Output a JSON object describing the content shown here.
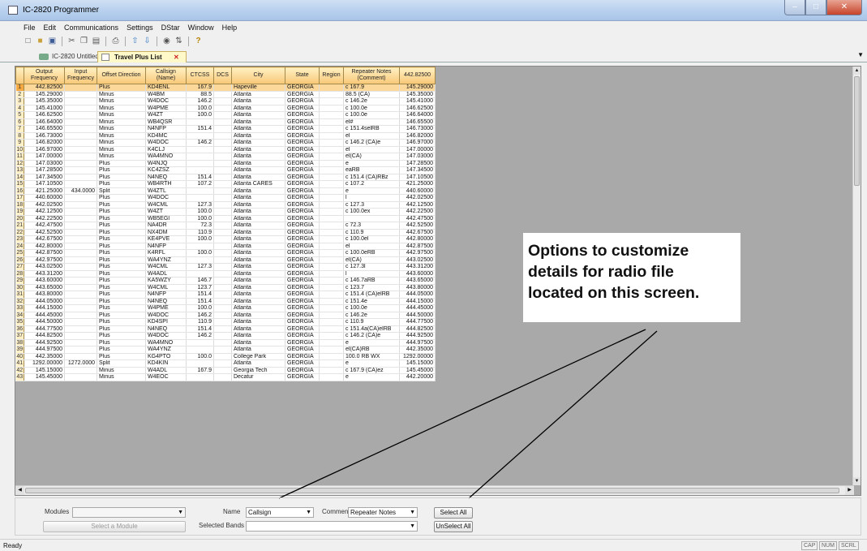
{
  "window": {
    "title": "IC-2820 Programmer",
    "controls": [
      "–",
      "□",
      "✕"
    ]
  },
  "menu": [
    "File",
    "Edit",
    "Communications",
    "Settings",
    "DStar",
    "Window",
    "Help"
  ],
  "toolbar_icons": [
    "new-icon",
    "open-icon",
    "save-icon",
    "cut-icon",
    "copy-icon",
    "paste-icon",
    "print-icon",
    "upload-icon",
    "download-icon",
    "binoculars-icon",
    "sort-icon",
    "help-icon"
  ],
  "tabs": {
    "doc1": "IC-2820 Untitled",
    "doc2": "Travel Plus List",
    "close": "✕",
    "dropdown": "▼"
  },
  "grid": {
    "headers": [
      "Output Frequency",
      "Input Frequency",
      "Offset Direction",
      "Callsign (Name)",
      "CTCSS",
      "DCS",
      "City",
      "State",
      "Region",
      "Repeater Notes (Comment)",
      "442.82500"
    ],
    "rows": [
      [
        "1",
        "442.82500",
        "",
        "Plus",
        "KD4ENL",
        "167.9",
        "",
        "Hapeville",
        "GEORGIA",
        "",
        "c 167.9",
        "145.29000"
      ],
      [
        "2",
        "145.29000",
        "",
        "Minus",
        "W4BM",
        "88.5",
        "",
        "Atlanta",
        "GEORGIA",
        "",
        "88.5 (CA)",
        "145.35000"
      ],
      [
        "3",
        "145.35000",
        "",
        "Minus",
        "W4DOC",
        "146.2",
        "",
        "Atlanta",
        "GEORGIA",
        "",
        "c 146.2e",
        "145.41000"
      ],
      [
        "4",
        "145.41000",
        "",
        "Minus",
        "W4PME",
        "100.0",
        "",
        "Atlanta",
        "GEORGIA",
        "",
        "c 100.0e",
        "146.62500"
      ],
      [
        "5",
        "146.62500",
        "",
        "Minus",
        "W4ZT",
        "100.0",
        "",
        "Atlanta",
        "GEORGIA",
        "",
        "c 100.0e",
        "146.64000"
      ],
      [
        "6",
        "146.64000",
        "",
        "Minus",
        "WB4QSR",
        "",
        "",
        "Atlanta",
        "GEORGIA",
        "",
        "el#",
        "146.65500"
      ],
      [
        "7",
        "146.65500",
        "",
        "Minus",
        "N4NFP",
        "151.4",
        "",
        "Atlanta",
        "GEORGIA",
        "",
        "c 151.4selRB",
        "146.73000"
      ],
      [
        "8",
        "146.73000",
        "",
        "Minus",
        "KD4MC",
        "",
        "",
        "Atlanta",
        "GEORGIA",
        "",
        "el",
        "146.82000"
      ],
      [
        "9",
        "146.82000",
        "",
        "Minus",
        "W4DOC",
        "146.2",
        "",
        "Atlanta",
        "GEORGIA",
        "",
        "c 146.2 (CA)e",
        "146.97000"
      ],
      [
        "10",
        "146.97000",
        "",
        "Minus",
        "K4CLJ",
        "",
        "",
        "Atlanta",
        "GEORGIA",
        "",
        "el",
        "147.00000"
      ],
      [
        "11",
        "147.00000",
        "",
        "Minus",
        "WA4MNO",
        "",
        "",
        "Atlanta",
        "GEORGIA",
        "",
        "el(CA)",
        "147.03000"
      ],
      [
        "12",
        "147.03000",
        "",
        "Plus",
        "W4NJQ",
        "",
        "",
        "Atlanta",
        "GEORGIA",
        "",
        "e",
        "147.28500"
      ],
      [
        "13",
        "147.28500",
        "",
        "Plus",
        "KC4ZSZ",
        "",
        "",
        "Atlanta",
        "GEORGIA",
        "",
        "eaRB",
        "147.34500"
      ],
      [
        "14",
        "147.34500",
        "",
        "Plus",
        "N4NEQ",
        "151.4",
        "",
        "Atlanta",
        "GEORGIA",
        "",
        "c 151.4 (CA)RBz",
        "147.10500"
      ],
      [
        "15",
        "147.10500",
        "",
        "Plus",
        "WB4RTH",
        "107.2",
        "",
        "Atlanta CARES",
        "GEORGIA",
        "",
        "c 107.2",
        "421.25000"
      ],
      [
        "16",
        "421.25000",
        "434.0000",
        "Split",
        "W4ZTL",
        "",
        "",
        "Atlanta",
        "GEORGIA",
        "",
        "e",
        "440.60000"
      ],
      [
        "17",
        "440.60000",
        "",
        "Plus",
        "W4DOC",
        "",
        "",
        "Atlanta",
        "GEORGIA",
        "",
        "l",
        "442.02500"
      ],
      [
        "18",
        "442.02500",
        "",
        "Plus",
        "W4CML",
        "127.3",
        "",
        "Atlanta",
        "GEORGIA",
        "",
        "c 127.3",
        "442.12500"
      ],
      [
        "19",
        "442.12500",
        "",
        "Plus",
        "W4ZT",
        "100.0",
        "",
        "Atlanta",
        "GEORGIA",
        "",
        "c 100.0ex",
        "442.22500"
      ],
      [
        "20",
        "442.22500",
        "",
        "Plus",
        "WB5EGI",
        "100.0",
        "",
        "Atlanta",
        "GEORGIA",
        "",
        "",
        "442.47500"
      ],
      [
        "21",
        "442.47500",
        "",
        "Plus",
        "NA4DR",
        "72.3",
        "",
        "Atlanta",
        "GEORGIA",
        "",
        "c 72.3",
        "442.52500"
      ],
      [
        "22",
        "442.52500",
        "",
        "Plus",
        "NX4DM",
        "110.9",
        "",
        "Atlanta",
        "GEORGIA",
        "",
        "c 110.9",
        "442.67500"
      ],
      [
        "23",
        "442.67500",
        "",
        "Plus",
        "KE4PVE",
        "100.0",
        "",
        "Atlanta",
        "GEORGIA",
        "",
        "c 100.0el",
        "442.80000"
      ],
      [
        "24",
        "442.80000",
        "",
        "Plus",
        "N4NFP",
        "",
        "",
        "Atlanta",
        "GEORGIA",
        "",
        "el",
        "442.87500"
      ],
      [
        "25",
        "442.87500",
        "",
        "Plus",
        "K4RFL",
        "100.0",
        "",
        "Atlanta",
        "GEORGIA",
        "",
        "c 100.0eRB",
        "442.97500"
      ],
      [
        "26",
        "442.97500",
        "",
        "Plus",
        "WA4YNZ",
        "",
        "",
        "Atlanta",
        "GEORGIA",
        "",
        "el(CA)",
        "443.02500"
      ],
      [
        "27",
        "443.02500",
        "",
        "Plus",
        "W4CML",
        "127.3",
        "",
        "Atlanta",
        "GEORGIA",
        "",
        "c 127.3l",
        "443.31200"
      ],
      [
        "28",
        "443.31200",
        "",
        "Plus",
        "W4ADL",
        "",
        "",
        "Atlanta",
        "GEORGIA",
        "",
        "l",
        "443.60000"
      ],
      [
        "29",
        "443.60000",
        "",
        "Plus",
        "KA5WZY",
        "146.7",
        "",
        "Atlanta",
        "GEORGIA",
        "",
        "c 146.7aRB",
        "443.65000"
      ],
      [
        "30",
        "443.65000",
        "",
        "Plus",
        "W4CML",
        "123.7",
        "",
        "Atlanta",
        "GEORGIA",
        "",
        "c 123.7",
        "443.80000"
      ],
      [
        "31",
        "443.80000",
        "",
        "Plus",
        "N4NFP",
        "151.4",
        "",
        "Atlanta",
        "GEORGIA",
        "",
        "c 151.4 (CA)elRB",
        "444.05000"
      ],
      [
        "32",
        "444.05000",
        "",
        "Plus",
        "N4NEQ",
        "151.4",
        "",
        "Atlanta",
        "GEORGIA",
        "",
        "c 151.4e",
        "444.15000"
      ],
      [
        "33",
        "444.15000",
        "",
        "Plus",
        "W4PME",
        "100.0",
        "",
        "Atlanta",
        "GEORGIA",
        "",
        "c 100.0e",
        "444.45000"
      ],
      [
        "34",
        "444.45000",
        "",
        "Plus",
        "W4DOC",
        "146.2",
        "",
        "Atlanta",
        "GEORGIA",
        "",
        "c 146.2e",
        "444.50000"
      ],
      [
        "35",
        "444.50000",
        "",
        "Plus",
        "KD4SPI",
        "110.9",
        "",
        "Atlanta",
        "GEORGIA",
        "",
        "c 110.9",
        "444.77500"
      ],
      [
        "36",
        "444.77500",
        "",
        "Plus",
        "N4NEQ",
        "151.4",
        "",
        "Atlanta",
        "GEORGIA",
        "",
        "c 151.4a(CA)elRB",
        "444.82500"
      ],
      [
        "37",
        "444.82500",
        "",
        "Plus",
        "W4DOC",
        "146.2",
        "",
        "Atlanta",
        "GEORGIA",
        "",
        "c 146.2 (CA)e",
        "444.92500"
      ],
      [
        "38",
        "444.92500",
        "",
        "Plus",
        "WA4MNO",
        "",
        "",
        "Atlanta",
        "GEORGIA",
        "",
        "e",
        "444.97500"
      ],
      [
        "39",
        "444.97500",
        "",
        "Plus",
        "WA4YNZ",
        "",
        "",
        "Atlanta",
        "GEORGIA",
        "",
        "el(CA)RB",
        "442.35000"
      ],
      [
        "40",
        "442.35000",
        "",
        "Plus",
        "KG4PTO",
        "100.0",
        "",
        "College Park",
        "GEORGIA",
        "",
        "100.0 RB WX",
        "1292.00000"
      ],
      [
        "41",
        "1292.00000",
        "1272.0000",
        "Split",
        "KD4KIN",
        "",
        "",
        "Atlanta",
        "GEORGIA",
        "",
        "e",
        "145.15000"
      ],
      [
        "42",
        "145.15000",
        "",
        "Minus",
        "W4ADL",
        "167.9",
        "",
        "Georgia Tech",
        "GEORGIA",
        "",
        "c 167.9 (CA)ez",
        "145.45000"
      ],
      [
        "43",
        "145.45000",
        "",
        "Minus",
        "W4EOC",
        "",
        "",
        "Decatur",
        "GEORGIA",
        "",
        "e",
        "442.20000"
      ]
    ]
  },
  "callout": {
    "lines": [
      "Options to customize",
      "details for radio file",
      "located on this screen."
    ]
  },
  "bottom": {
    "modules_label": "Modules",
    "modules_value": "",
    "select_module_label": "Select a Module",
    "name_label": "Name",
    "name_value": "Callsign",
    "comment_label": "Comment",
    "comment_value": "Repeater Notes",
    "select_all_label": "Select All",
    "selected_bands_label": "Selected Bands",
    "selected_bands_value": "",
    "unselect_all_label": "UnSelect All"
  },
  "status": {
    "text": "Ready",
    "indicators": [
      "CAP",
      "NUM",
      "SCRL"
    ]
  }
}
